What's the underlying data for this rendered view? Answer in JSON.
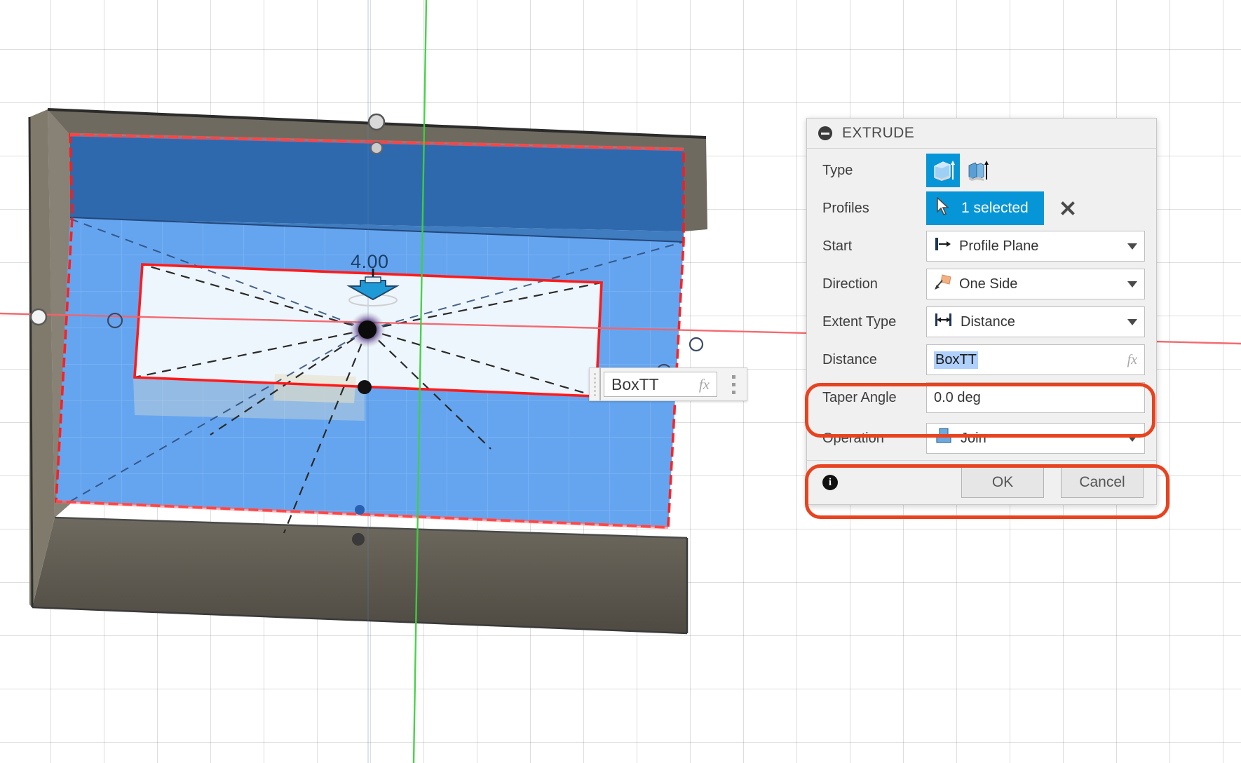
{
  "canvas": {
    "dimension_label": "4.00",
    "floating_input": {
      "value": "BoxTT",
      "fx_label": "fx",
      "grip_icon": "drag-grip-icon",
      "more_icon": "more-options-icon"
    }
  },
  "dialog": {
    "title": "EXTRUDE",
    "collapse_icon": "collapse-icon",
    "rows": {
      "type": {
        "label": "Type",
        "options": [
          {
            "icon": "solid-extrude-icon",
            "selected": true
          },
          {
            "icon": "thin-extrude-icon",
            "selected": false
          }
        ]
      },
      "profiles": {
        "label": "Profiles",
        "value": "1 selected",
        "cursor_icon": "select-cursor-icon",
        "clear_icon": "clear-selection-x-icon"
      },
      "start": {
        "label": "Start",
        "value": "Profile Plane",
        "icon": "profile-plane-icon",
        "caret": "chevron-down-icon"
      },
      "direction": {
        "label": "Direction",
        "value": "One Side",
        "icon": "one-side-icon",
        "caret": "chevron-down-icon"
      },
      "extent_type": {
        "label": "Extent Type",
        "value": "Distance",
        "icon": "distance-measure-icon",
        "caret": "chevron-down-icon"
      },
      "distance": {
        "label": "Distance",
        "value": "BoxTT",
        "fx_label": "fx",
        "highlighted": true
      },
      "taper_angle": {
        "label": "Taper Angle",
        "value": "0.0 deg"
      },
      "operation": {
        "label": "Operation",
        "value": "Join",
        "icon": "join-operation-icon",
        "caret": "chevron-down-icon",
        "highlighted": true
      }
    },
    "footer": {
      "info_icon": "info-icon",
      "info_glyph": "i",
      "ok_label": "OK",
      "cancel_label": "Cancel"
    }
  },
  "colors": {
    "accent_blue": "#0696d7",
    "highlight_red": "#e8421f",
    "panel_bg": "#f0f0f0",
    "selection_blue": "#aed0fb",
    "body_top_face": "#2f69ad",
    "sketch_face": "#65a5f0",
    "solid_gray": "#6f6a5f",
    "profile_face": "#eef6fd",
    "axis_red": "#f4636a",
    "axis_green": "#3fd13f",
    "edge_highlight": "#ff1a1a"
  }
}
